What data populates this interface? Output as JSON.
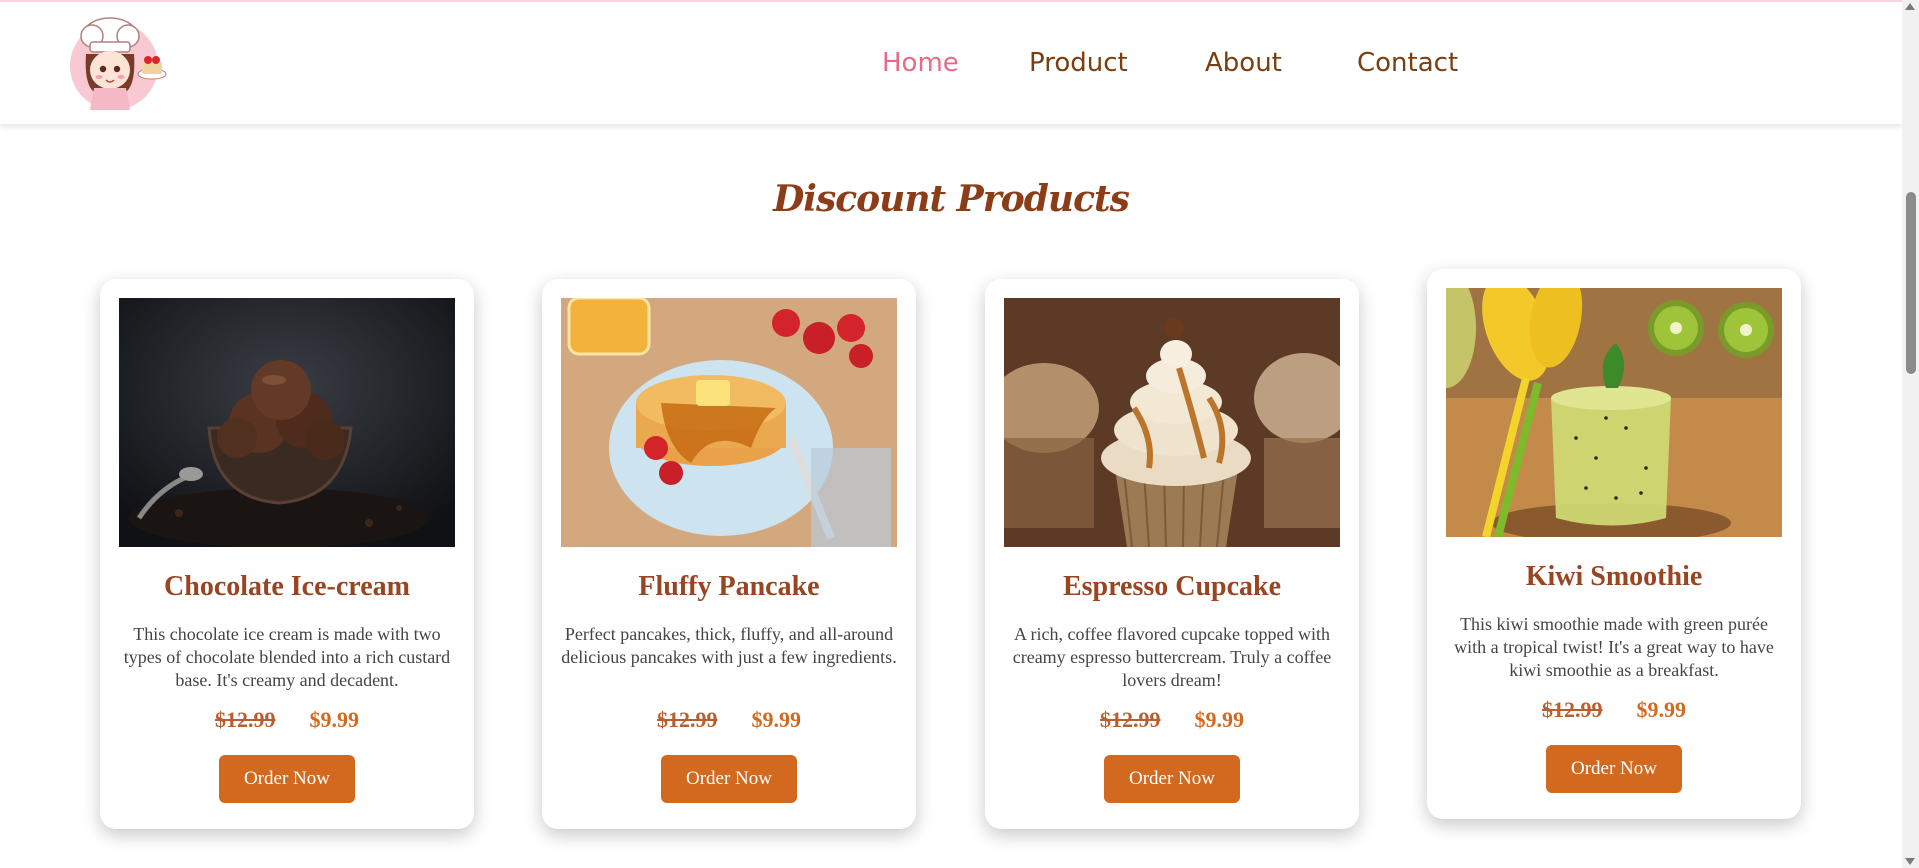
{
  "header": {
    "logo_alt": "chef girl logo",
    "nav": [
      {
        "label": "Home",
        "active": true
      },
      {
        "label": "Product",
        "active": false
      },
      {
        "label": "About",
        "active": false
      },
      {
        "label": "Contact",
        "active": false
      }
    ]
  },
  "section": {
    "title": "Discount Products"
  },
  "products": [
    {
      "image_icon": "chocolate-ice-cream-image",
      "name": "Chocolate Ice-cream",
      "description": "This chocolate ice cream is made with two types of chocolate blended into a rich custard base. It's creamy and decadent.",
      "old_price": "$12.99",
      "new_price": "$9.99",
      "button": "Order Now"
    },
    {
      "image_icon": "pancake-image",
      "name": "Fluffy Pancake",
      "description": "Perfect pancakes, thick, fluffy, and all-around delicious pancakes with just a few ingredients.",
      "old_price": "$12.99",
      "new_price": "$9.99",
      "button": "Order Now"
    },
    {
      "image_icon": "cupcake-image",
      "name": "Espresso Cupcake",
      "description": "A rich, coffee flavored cupcake topped with creamy espresso buttercream. Truly a coffee lovers dream!",
      "old_price": "$12.99",
      "new_price": "$9.99",
      "button": "Order Now"
    },
    {
      "image_icon": "kiwi-smoothie-image",
      "name": "Kiwi Smoothie",
      "description": "This kiwi smoothie made with green purée with a tropical twist! It's a great way to have kiwi smoothie as a breakfast.",
      "old_price": "$12.99",
      "new_price": "$9.99",
      "button": "Order Now"
    }
  ],
  "colors": {
    "accent": "#d2691e",
    "nav_active": "#e86b86",
    "nav_text": "#7a3e10",
    "title": "#8b3d18"
  }
}
